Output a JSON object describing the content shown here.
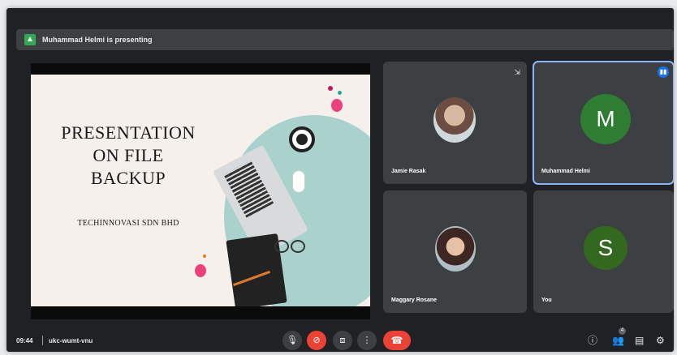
{
  "banner": {
    "text": "Muhammad Helmi is presenting"
  },
  "slide": {
    "title_lines": [
      "PRESENTATION",
      "ON FILE",
      "BACKUP"
    ],
    "subtitle": "TECHINNOVASI SDN BHD"
  },
  "participants": [
    {
      "name": "Jamie Rasak",
      "avatar": "photo"
    },
    {
      "name": "Muhammad Helmi",
      "avatar_letter": "M",
      "speaking": true
    },
    {
      "name": "Maggary Rosane",
      "avatar": "photo"
    },
    {
      "name": "You",
      "avatar_letter": "S"
    }
  ],
  "meeting": {
    "time": "09:44",
    "code": "ukc-wumt-vnu"
  },
  "people_count": "4",
  "colors": {
    "background": "#202124",
    "tile": "#3c4043",
    "accent_green": "#34a853",
    "hangup_red": "#ea4335",
    "speaking_blue": "#8ab4f8",
    "avatar_m": "#2e7d32",
    "avatar_s": "#33691e"
  },
  "icons": {
    "mic": "mic-icon",
    "camera_off": "camera-off-icon",
    "present": "present-screen-icon",
    "more": "more-options-icon",
    "hangup": "hangup-icon",
    "info": "info-icon",
    "people": "people-icon",
    "chat": "chat-icon",
    "activities": "activities-icon"
  }
}
